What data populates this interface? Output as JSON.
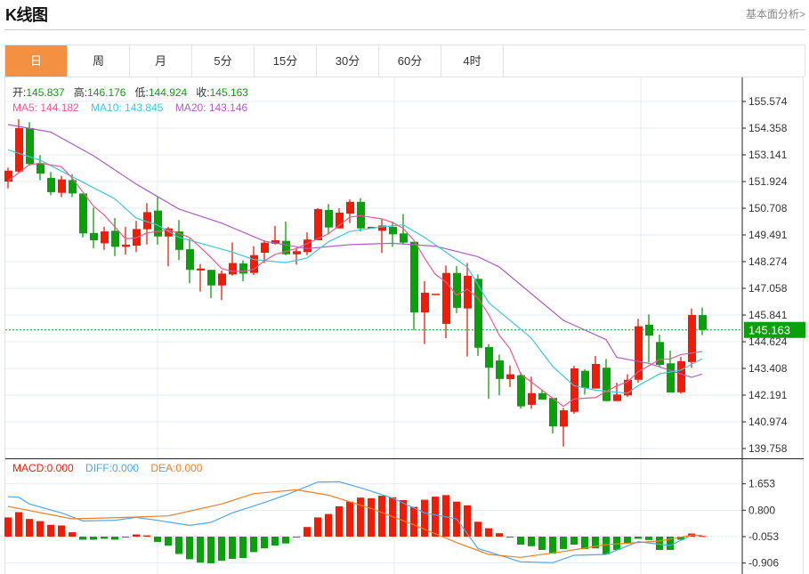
{
  "header": {
    "title": "K线图",
    "link": "基本面分析>"
  },
  "tabs": [
    {
      "label": "日",
      "active": true
    },
    {
      "label": "周"
    },
    {
      "label": "月"
    },
    {
      "label": "5分"
    },
    {
      "label": "15分"
    },
    {
      "label": "30分"
    },
    {
      "label": "60分"
    },
    {
      "label": "4时"
    }
  ],
  "ohlc_legend": {
    "open_label": "开:",
    "open": "145.837",
    "high_label": "高:",
    "high": "146.176",
    "low_label": "低:",
    "low": "144.924",
    "close_label": "收:",
    "close": "145.163"
  },
  "ma_legend": {
    "ma5": "MA5: 144.182",
    "ma10": "MA10: 143.845",
    "ma20": "MA20: 143.146"
  },
  "macd_legend": {
    "macd": "MACD:0.000",
    "diff": "DIFF:0.000",
    "dea": "DEA:0.000"
  },
  "colors": {
    "up": "#f21b05",
    "down": "#09a109",
    "ma5": "#f0588a",
    "ma10": "#3cc8de",
    "ma20": "#b05cc9",
    "diff": "#4aa8f0",
    "dea": "#f57d1f",
    "accent": "#f39041"
  },
  "chart_data": [
    {
      "type": "candlestick",
      "title": "K线图",
      "current_price": "145.163",
      "yticks": [
        "155.574",
        "154.358",
        "153.141",
        "151.924",
        "150.708",
        "149.491",
        "148.274",
        "147.058",
        "145.841",
        "144.624",
        "143.408",
        "142.191",
        "140.974",
        "139.758"
      ],
      "ylim": [
        139.758,
        155.574
      ],
      "candles": [
        [
          151.92,
          152.56,
          151.61,
          152.42
        ],
        [
          152.38,
          154.76,
          152.33,
          154.36
        ],
        [
          154.36,
          154.63,
          152.65,
          152.72
        ],
        [
          152.76,
          153.13,
          151.98,
          152.29
        ],
        [
          152.09,
          152.36,
          151.3,
          151.44
        ],
        [
          151.41,
          152.18,
          151.21,
          152.02
        ],
        [
          151.99,
          152.26,
          151.21,
          151.38
        ],
        [
          151.38,
          151.38,
          149.38,
          149.56
        ],
        [
          149.58,
          150.74,
          148.88,
          149.25
        ],
        [
          149.11,
          149.86,
          148.81,
          149.65
        ],
        [
          149.68,
          150.26,
          148.53,
          148.95
        ],
        [
          148.95,
          149.86,
          148.6,
          149.05
        ],
        [
          149.0,
          150.13,
          148.71,
          149.76
        ],
        [
          149.75,
          150.94,
          149.05,
          150.53
        ],
        [
          150.6,
          151.25,
          149.05,
          149.42
        ],
        [
          149.42,
          149.86,
          148.06,
          149.79
        ],
        [
          149.65,
          150.17,
          148.34,
          148.81
        ],
        [
          148.84,
          149.32,
          147.29,
          147.9
        ],
        [
          147.87,
          148.17,
          146.91,
          147.96
        ],
        [
          147.9,
          147.9,
          146.61,
          147.19
        ],
        [
          147.19,
          147.87,
          146.52,
          147.73
        ],
        [
          147.69,
          149.15,
          147.63,
          148.21
        ],
        [
          148.19,
          148.33,
          147.38,
          147.73
        ],
        [
          147.76,
          148.98,
          147.67,
          148.57
        ],
        [
          148.68,
          149.25,
          148.21,
          149.14
        ],
        [
          149.09,
          149.9,
          149.05,
          149.25
        ],
        [
          149.22,
          150.1,
          148.57,
          148.61
        ],
        [
          148.61,
          148.91,
          148.14,
          148.75
        ],
        [
          148.71,
          149.61,
          148.57,
          149.28
        ],
        [
          149.25,
          150.71,
          149.25,
          150.67
        ],
        [
          150.63,
          150.9,
          149.52,
          149.83
        ],
        [
          149.79,
          150.71,
          149.79,
          150.51
        ],
        [
          150.46,
          151.11,
          150.03,
          151.0
        ],
        [
          151.0,
          151.17,
          149.65,
          149.79
        ],
        [
          149.79,
          149.86,
          149.79,
          149.86
        ],
        [
          149.68,
          150.19,
          148.67,
          149.92
        ],
        [
          149.86,
          150.1,
          148.95,
          149.52
        ],
        [
          149.56,
          150.44,
          149.05,
          149.14
        ],
        [
          149.18,
          149.18,
          145.16,
          145.96
        ],
        [
          145.96,
          147.38,
          144.52,
          146.86
        ],
        [
          146.81,
          146.81,
          146.81,
          146.81
        ],
        [
          145.44,
          148.1,
          144.79,
          147.76
        ],
        [
          147.76,
          148.07,
          145.93,
          146.17
        ],
        [
          146.14,
          148.21,
          143.95,
          147.63
        ],
        [
          147.49,
          147.69,
          143.98,
          144.35
        ],
        [
          144.38,
          144.52,
          142.02,
          143.44
        ],
        [
          143.77,
          144.04,
          142.18,
          142.93
        ],
        [
          142.92,
          143.54,
          142.56,
          143.14
        ],
        [
          143.1,
          143.23,
          141.58,
          141.68
        ],
        [
          141.75,
          143.03,
          141.57,
          142.28
        ],
        [
          142.28,
          142.42,
          141.99,
          141.99
        ],
        [
          142.06,
          142.06,
          140.44,
          140.77
        ],
        [
          140.76,
          141.61,
          139.85,
          141.5
        ],
        [
          141.43,
          143.53,
          141.34,
          143.41
        ],
        [
          143.3,
          143.37,
          142.22,
          142.52
        ],
        [
          142.49,
          143.98,
          142.49,
          143.61
        ],
        [
          143.44,
          143.84,
          141.92,
          141.92
        ],
        [
          141.92,
          142.76,
          141.92,
          142.22
        ],
        [
          142.18,
          143.14,
          142.11,
          142.89
        ],
        [
          142.89,
          145.67,
          142.76,
          145.33
        ],
        [
          145.4,
          145.87,
          143.68,
          144.9
        ],
        [
          144.61,
          144.95,
          143.5,
          143.57
        ],
        [
          143.64,
          144.22,
          142.31,
          142.31
        ],
        [
          142.32,
          143.94,
          142.26,
          143.74
        ],
        [
          143.7,
          146.14,
          143.44,
          145.84
        ],
        [
          145.837,
          146.176,
          144.924,
          145.163
        ]
      ],
      "ma5": [
        [
          0,
          151.95
        ],
        [
          2,
          152.69
        ],
        [
          3,
          152.76
        ],
        [
          5,
          152.6
        ],
        [
          6,
          152.09
        ],
        [
          8,
          150.81
        ],
        [
          9,
          150.4
        ],
        [
          11,
          149.32
        ],
        [
          12,
          149.36
        ],
        [
          13,
          149.58
        ],
        [
          15,
          149.72
        ],
        [
          17,
          149.38
        ],
        [
          19,
          148.47
        ],
        [
          20,
          147.96
        ],
        [
          21,
          147.83
        ],
        [
          22,
          147.83
        ],
        [
          23,
          147.92
        ],
        [
          24,
          148.31
        ],
        [
          25,
          148.6
        ],
        [
          27,
          148.87
        ],
        [
          29,
          149.32
        ],
        [
          30,
          149.54
        ],
        [
          32,
          150.3
        ],
        [
          33,
          150.37
        ],
        [
          35,
          150.22
        ],
        [
          36,
          150.06
        ],
        [
          37,
          149.79
        ],
        [
          38,
          149.25
        ],
        [
          39,
          148.44
        ],
        [
          40,
          147.7
        ],
        [
          41,
          147.35
        ],
        [
          42,
          146.75
        ],
        [
          43,
          147.02
        ],
        [
          44,
          146.61
        ],
        [
          45,
          145.87
        ],
        [
          46,
          144.92
        ],
        [
          47,
          144.31
        ],
        [
          48,
          143.16
        ],
        [
          50,
          142.42
        ],
        [
          52,
          141.68
        ],
        [
          53,
          142.02
        ],
        [
          55,
          142.08
        ],
        [
          57,
          142.62
        ],
        [
          58,
          142.79
        ],
        [
          59,
          143.25
        ],
        [
          61,
          143.81
        ],
        [
          62,
          143.84
        ],
        [
          63,
          144.04
        ],
        [
          65,
          144.18
        ]
      ],
      "ma10": [
        [
          0,
          153.37
        ],
        [
          3,
          152.9
        ],
        [
          6,
          152.15
        ],
        [
          10,
          151.14
        ],
        [
          12,
          150.26
        ],
        [
          14,
          149.94
        ],
        [
          16,
          149.38
        ],
        [
          19,
          148.98
        ],
        [
          21,
          148.71
        ],
        [
          23,
          148.37
        ],
        [
          26,
          148.23
        ],
        [
          28,
          148.44
        ],
        [
          30,
          149.18
        ],
        [
          32,
          149.65
        ],
        [
          35,
          149.86
        ],
        [
          37,
          149.95
        ],
        [
          39,
          149.38
        ],
        [
          41,
          148.71
        ],
        [
          43,
          148.03
        ],
        [
          45,
          146.41
        ],
        [
          47,
          145.6
        ],
        [
          49,
          144.79
        ],
        [
          51,
          143.5
        ],
        [
          53,
          142.62
        ],
        [
          55,
          142.42
        ],
        [
          58,
          142.28
        ],
        [
          59,
          142.62
        ],
        [
          61,
          143.16
        ],
        [
          63,
          143.33
        ],
        [
          65,
          143.85
        ]
      ],
      "ma20": [
        [
          0,
          154.52
        ],
        [
          4,
          154.18
        ],
        [
          8,
          153.1
        ],
        [
          12,
          151.81
        ],
        [
          16,
          150.67
        ],
        [
          20,
          150.03
        ],
        [
          24,
          149.21
        ],
        [
          28,
          148.87
        ],
        [
          32,
          149.05
        ],
        [
          36,
          149.11
        ],
        [
          40,
          148.98
        ],
        [
          44,
          148.5
        ],
        [
          46,
          148.03
        ],
        [
          48,
          147.22
        ],
        [
          52,
          145.6
        ],
        [
          56,
          144.72
        ],
        [
          57,
          143.91
        ],
        [
          60,
          143.64
        ],
        [
          64,
          143.0
        ],
        [
          65,
          143.15
        ]
      ]
    },
    {
      "type": "bar+line",
      "title": "MACD",
      "yticks": [
        "1.653",
        "0.800",
        "-0.053",
        "-0.906"
      ],
      "baseline": -0.053,
      "histogram": [
        0.62,
        0.79,
        0.57,
        0.5,
        0.38,
        0.36,
        0.14,
        -0.1,
        -0.1,
        -0.07,
        -0.1,
        -0.03,
        0.07,
        0.04,
        -0.17,
        -0.29,
        -0.56,
        -0.73,
        -0.84,
        -0.86,
        -0.78,
        -0.72,
        -0.69,
        -0.5,
        -0.38,
        -0.29,
        -0.22,
        -0.02,
        0.31,
        0.62,
        0.73,
        0.98,
        1.13,
        1.26,
        1.24,
        1.32,
        1.27,
        1.18,
        0.96,
        1.19,
        1.29,
        1.34,
        1.13,
        1.01,
        0.48,
        0.27,
        0.11,
        -0.03,
        -0.26,
        -0.31,
        -0.43,
        -0.55,
        -0.4,
        -0.26,
        -0.4,
        -0.38,
        -0.57,
        -0.43,
        -0.22,
        -0.07,
        -0.11,
        -0.43,
        -0.43,
        -0.1,
        0.1,
        0.02
      ],
      "diff": [
        [
          0,
          1.239
        ],
        [
          1,
          1.22
        ],
        [
          2,
          1.0
        ],
        [
          5,
          0.713
        ],
        [
          7,
          0.454
        ],
        [
          10,
          0.474
        ],
        [
          12,
          0.569
        ],
        [
          14,
          0.474
        ],
        [
          17,
          0.311
        ],
        [
          19,
          0.407
        ],
        [
          21,
          0.713
        ],
        [
          24,
          1.048
        ],
        [
          26,
          1.287
        ],
        [
          29,
          1.708
        ],
        [
          31,
          1.718
        ],
        [
          33,
          1.527
        ],
        [
          36,
          1.192
        ],
        [
          39,
          0.713
        ],
        [
          42,
          0.521
        ],
        [
          44,
          -0.436
        ],
        [
          48,
          -0.867
        ],
        [
          51,
          -0.895
        ],
        [
          53,
          -0.656
        ],
        [
          56,
          -0.627
        ],
        [
          59,
          -0.216
        ],
        [
          62,
          -0.34
        ],
        [
          64,
          -0.005
        ],
        [
          65,
          -0.02
        ]
      ],
      "dea": [
        [
          0,
          0.923
        ],
        [
          6,
          0.521
        ],
        [
          11,
          0.569
        ],
        [
          15,
          0.617
        ],
        [
          20,
          1.0
        ],
        [
          23,
          1.335
        ],
        [
          27,
          1.46
        ],
        [
          30,
          1.287
        ],
        [
          34,
          0.856
        ],
        [
          38,
          0.33
        ],
        [
          42,
          -0.244
        ],
        [
          45,
          -0.627
        ],
        [
          48,
          -0.723
        ],
        [
          52,
          -0.532
        ],
        [
          56,
          -0.311
        ],
        [
          61,
          -0.197
        ],
        [
          64,
          -0.005
        ],
        [
          65,
          -0.02
        ]
      ]
    }
  ]
}
